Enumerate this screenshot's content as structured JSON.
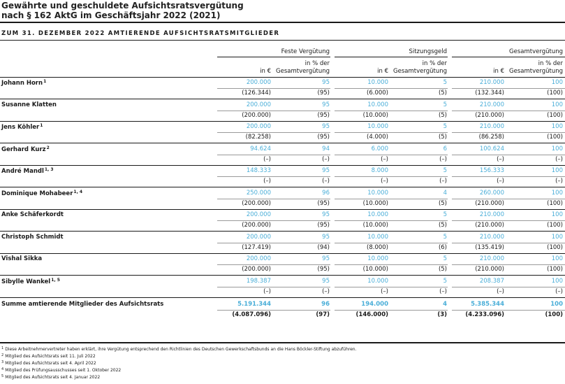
{
  "title_line1": "Gewährte und geschuldete Aufsichtsratsvergütung",
  "title_line2": "nach § 162 AktG im Geschäftsjahr 2022 (2021)",
  "section_title": "ZUM 31. DEZEMBER 2022 AMTIERENDE AUFSICHTSRATSMITGLIEDER",
  "groups": [
    "Feste Vergütung",
    "Sitzungsgeld",
    "Gesamtvergütung"
  ],
  "col_headers": {
    "eur": "in €",
    "pct_line1": "in % der",
    "pct_line2": "Gesamtvergütung"
  },
  "rows": [
    {
      "name": "Johann Horn",
      "sup": "1",
      "cur": [
        "200.000",
        "95",
        "10.000",
        "5",
        "210.000",
        "100"
      ],
      "prev": [
        "(126.344)",
        "(95)",
        "(6.000)",
        "(5)",
        "(132.344)",
        "(100)"
      ]
    },
    {
      "name": "Susanne Klatten",
      "sup": "",
      "cur": [
        "200.000",
        "95",
        "10.000",
        "5",
        "210.000",
        "100"
      ],
      "prev": [
        "(200.000)",
        "(95)",
        "(10.000)",
        "(5)",
        "(210.000)",
        "(100)"
      ]
    },
    {
      "name": "Jens Köhler",
      "sup": "1",
      "cur": [
        "200.000",
        "95",
        "10.000",
        "5",
        "210.000",
        "100"
      ],
      "prev": [
        "(82.258)",
        "(95)",
        "(4.000)",
        "(5)",
        "(86.258)",
        "(100)"
      ]
    },
    {
      "name": "Gerhard Kurz",
      "sup": "2",
      "cur": [
        "94.624",
        "94",
        "6.000",
        "6",
        "100.624",
        "100"
      ],
      "prev": [
        "(–)",
        "(–)",
        "(–)",
        "(–)",
        "(–)",
        "(–)"
      ]
    },
    {
      "name": "André Mandl",
      "sup": "1, 3",
      "cur": [
        "148.333",
        "95",
        "8.000",
        "5",
        "156.333",
        "100"
      ],
      "prev": [
        "(–)",
        "(–)",
        "(–)",
        "(–)",
        "(–)",
        "(–)"
      ]
    },
    {
      "name": "Dominique Mohabeer",
      "sup": "1, 4",
      "cur": [
        "250.000",
        "96",
        "10.000",
        "4",
        "260.000",
        "100"
      ],
      "prev": [
        "(200.000)",
        "(95)",
        "(10.000)",
        "(5)",
        "(210.000)",
        "(100)"
      ]
    },
    {
      "name": "Anke Schäferkordt",
      "sup": "",
      "cur": [
        "200.000",
        "95",
        "10.000",
        "5",
        "210.000",
        "100"
      ],
      "prev": [
        "(200.000)",
        "(95)",
        "(10.000)",
        "(5)",
        "(210.000)",
        "(100)"
      ]
    },
    {
      "name": "Christoph Schmidt",
      "sup": "",
      "cur": [
        "200.000",
        "95",
        "10.000",
        "5",
        "210.000",
        "100"
      ],
      "prev": [
        "(127.419)",
        "(94)",
        "(8.000)",
        "(6)",
        "(135.419)",
        "(100)"
      ]
    },
    {
      "name": "Vishal Sikka",
      "sup": "",
      "cur": [
        "200.000",
        "95",
        "10.000",
        "5",
        "210.000",
        "100"
      ],
      "prev": [
        "(200.000)",
        "(95)",
        "(10.000)",
        "(5)",
        "(210.000)",
        "(100)"
      ]
    },
    {
      "name": "Sibylle Wankel",
      "sup": "1, 5",
      "cur": [
        "198.387",
        "95",
        "10.000",
        "5",
        "208.387",
        "100"
      ],
      "prev": [
        "(–)",
        "(–)",
        "(–)",
        "(–)",
        "(–)",
        "(–)"
      ]
    }
  ],
  "total": {
    "name": "Summe amtierende Mitglieder des Aufsichtsrats",
    "cur": [
      "5.191.344",
      "96",
      "194.000",
      "4",
      "5.385.344",
      "100"
    ],
    "prev": [
      "(4.087.096)",
      "(97)",
      "(146.000)",
      "(3)",
      "(4.233.096)",
      "(100)"
    ]
  },
  "footnotes": [
    {
      "num": "1",
      "text": "Diese Arbeitnehmervertreter haben erklärt, ihre Vergütung entsprechend den Richtlinien des Deutschen Gewerkschaftsbunds an die Hans Böckler-Stiftung abzuführen."
    },
    {
      "num": "2",
      "text": "Mitglied des Aufsichtsrats seit 11. Juli 2022"
    },
    {
      "num": "3",
      "text": "Mitglied des Aufsichtsrats seit 4. April 2022"
    },
    {
      "num": "4",
      "text": "Mitglied des Prüfungsausschusses seit 1. Oktober 2022"
    },
    {
      "num": "5",
      "text": "Mitglied des Aufsichtsrats seit 4. Januar 2022"
    }
  ],
  "colors": {
    "current": "#4aaed8",
    "previous": "#1a1a1a"
  }
}
